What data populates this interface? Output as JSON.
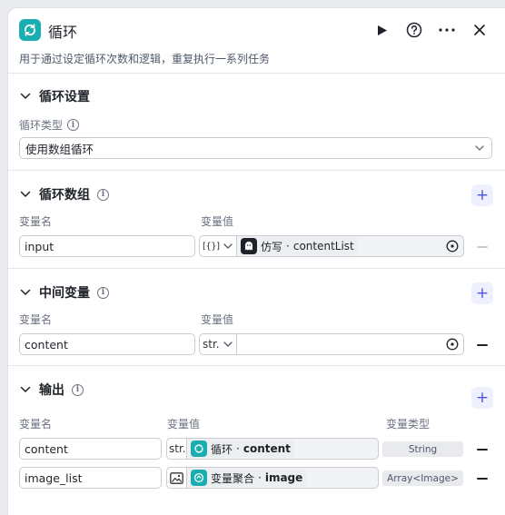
{
  "header": {
    "title": "循环",
    "description": "用于通过设定循环次数和逻辑，重复执行一系列任务",
    "logo_icon": "loop-icon",
    "accent": "#1aaeb0"
  },
  "loop_settings": {
    "title": "循环设置",
    "type_label": "循环类型",
    "type_value": "使用数组循环"
  },
  "loop_array": {
    "title": "循环数组",
    "col_name": "变量名",
    "col_value": "变量值",
    "row": {
      "name": "input",
      "type": "[{}]",
      "ref_node": "仿写",
      "ref_var": "contentList",
      "ref_icon": "ghost-icon"
    }
  },
  "intermediate": {
    "title": "中间变量",
    "col_name": "变量名",
    "col_value": "变量值",
    "row": {
      "name": "content",
      "type": "str."
    }
  },
  "output": {
    "title": "输出",
    "col_name": "变量名",
    "col_value": "变量值",
    "col_type": "变量类型",
    "rows": [
      {
        "name": "content",
        "type": "str.",
        "ref_node": "循环",
        "ref_var": "content",
        "var_type": "String"
      },
      {
        "name": "image_list",
        "type": "image-icon",
        "ref_node": "变量聚合",
        "ref_var": "image",
        "var_type": "Array<Image>"
      }
    ]
  }
}
